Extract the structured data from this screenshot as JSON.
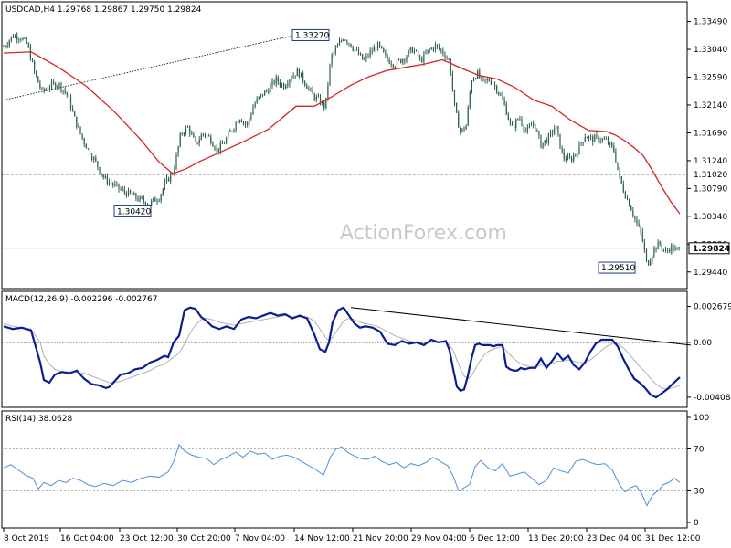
{
  "header": {
    "symbol_tf": "USDCAD,H4",
    "ohlc": "1.29768 1.29867 1.29750 1.29824"
  },
  "watermark": "ActionForex.com",
  "colors": {
    "candle": "#2f5f4f",
    "ma": "#d42424",
    "macd": "#0a1f8f",
    "signal": "#b0b0b0",
    "rsi": "#4a90d9",
    "trendline": "#000000",
    "frame": "#000000",
    "level_line": "#000000",
    "current_price_line": "#9a9a9a"
  },
  "chart_data": [
    {
      "type": "candlestick",
      "panel": "price",
      "y_ticks": [
        "1.33490",
        "1.33040",
        "1.32590",
        "1.32140",
        "1.31690",
        "1.31240",
        "1.30790",
        "1.30340",
        "1.29890",
        "1.29440"
      ],
      "ylim": [
        1.2923,
        1.3372
      ],
      "close_path": {
        "x": [
          0,
          10,
          18,
          26,
          34,
          42,
          50,
          60,
          70,
          78,
          86,
          94,
          102,
          110,
          120,
          130,
          140,
          150,
          160,
          170,
          178,
          186,
          194,
          202,
          210,
          218,
          226,
          234,
          242,
          250,
          258,
          266,
          274,
          282,
          290,
          298,
          306,
          314,
          322,
          330,
          338,
          346,
          352,
          358,
          366,
          372,
          378,
          386,
          394,
          402,
          410,
          418,
          428,
          438,
          448,
          456,
          464,
          472,
          480,
          488,
          494,
          500,
          506,
          512,
          518,
          524,
          532,
          540,
          548,
          556,
          564,
          572,
          580,
          588,
          596,
          604,
          612,
          620,
          628,
          636,
          644,
          652,
          660,
          668,
          674,
          680,
          686,
          692,
          698,
          704,
          708,
          712,
          718,
          724,
          730,
          736,
          740
        ],
        "close": [
          1.3308,
          1.3326,
          1.3324,
          1.3312,
          1.3265,
          1.3235,
          1.3245,
          1.3248,
          1.323,
          1.319,
          1.316,
          1.3138,
          1.3118,
          1.3095,
          1.3085,
          1.3075,
          1.3068,
          1.306,
          1.3055,
          1.3065,
          1.309,
          1.3108,
          1.3168,
          1.3178,
          1.315,
          1.3168,
          1.316,
          1.314,
          1.3155,
          1.3175,
          1.3195,
          1.318,
          1.3215,
          1.323,
          1.324,
          1.3255,
          1.3245,
          1.326,
          1.3268,
          1.325,
          1.323,
          1.322,
          1.321,
          1.329,
          1.331,
          1.3324,
          1.3315,
          1.33,
          1.3285,
          1.33,
          1.331,
          1.329,
          1.328,
          1.329,
          1.3305,
          1.3285,
          1.33,
          1.331,
          1.33,
          1.3285,
          1.3205,
          1.317,
          1.318,
          1.3255,
          1.3265,
          1.325,
          1.3255,
          1.324,
          1.3215,
          1.3175,
          1.3195,
          1.317,
          1.3185,
          1.315,
          1.316,
          1.318,
          1.313,
          1.3125,
          1.314,
          1.3165,
          1.3158,
          1.316,
          1.3155,
          1.314,
          1.3095,
          1.307,
          1.305,
          1.3025,
          1.3005,
          1.2955,
          1.2968,
          1.2982,
          1.299,
          1.2975,
          1.2985,
          1.2978,
          1.2982
        ]
      },
      "moving_average": {
        "x": [
          0,
          30,
          60,
          90,
          120,
          150,
          170,
          185,
          200,
          215,
          230,
          260,
          290,
          320,
          340,
          360,
          380,
          400,
          420,
          440,
          460,
          480,
          490,
          500,
          520,
          540,
          560,
          580,
          600,
          620,
          640,
          660,
          670,
          680,
          690,
          700,
          710,
          720,
          730,
          740
        ],
        "value": [
          1.3298,
          1.33,
          1.3275,
          1.3245,
          1.3205,
          1.3158,
          1.3122,
          1.3103,
          1.3111,
          1.3123,
          1.3133,
          1.3153,
          1.3175,
          1.3212,
          1.3212,
          1.3228,
          1.3246,
          1.326,
          1.327,
          1.3275,
          1.328,
          1.3287,
          1.3281,
          1.3274,
          1.3262,
          1.3256,
          1.3242,
          1.3222,
          1.3212,
          1.319,
          1.3173,
          1.3171,
          1.3165,
          1.3156,
          1.3145,
          1.3132,
          1.3108,
          1.3082,
          1.3058,
          1.3038
        ]
      },
      "annotations": [
        {
          "label": "1.33270",
          "value": 1.3327
        },
        {
          "label": "1.30420",
          "value": 1.3042
        },
        {
          "label": "1.29510",
          "value": 1.2951
        },
        {
          "label": "1.31020",
          "value": 1.3102
        },
        {
          "label": "1.29824",
          "value": 1.29824
        }
      ]
    },
    {
      "type": "line",
      "panel": "macd",
      "title": "MACD(12,26,9) -0.002296 -0.002767",
      "y_ticks": [
        "0.002679",
        "0.00",
        "-0.004086"
      ],
      "ylim": [
        -0.0045,
        0.0034
      ],
      "x": [
        0,
        10,
        20,
        30,
        40,
        44,
        50,
        56,
        64,
        72,
        80,
        88,
        96,
        104,
        112,
        116,
        120,
        128,
        136,
        144,
        152,
        160,
        168,
        176,
        180,
        186,
        192,
        198,
        204,
        210,
        216,
        222,
        228,
        236,
        244,
        252,
        260,
        268,
        276,
        284,
        292,
        300,
        308,
        316,
        324,
        332,
        340,
        346,
        352,
        356,
        360,
        366,
        372,
        378,
        384,
        390,
        396,
        404,
        412,
        420,
        428,
        436,
        444,
        452,
        460,
        468,
        476,
        484,
        488,
        492,
        496,
        500,
        504,
        508,
        512,
        516,
        520,
        524,
        528,
        532,
        536,
        540,
        546,
        550,
        554,
        558,
        562,
        566,
        570,
        576,
        582,
        588,
        594,
        600,
        606,
        612,
        618,
        624,
        630,
        636,
        642,
        648,
        654,
        660,
        666,
        672,
        678,
        684,
        690,
        696,
        702,
        708,
        714,
        720,
        726,
        732,
        740
      ],
      "macd": [
        0.0012,
        0.001,
        0.0011,
        0.0009,
        -0.0015,
        -0.0028,
        -0.003,
        -0.0024,
        -0.0022,
        -0.0023,
        -0.0021,
        -0.0027,
        -0.0031,
        -0.0032,
        -0.0034,
        -0.0033,
        -0.003,
        -0.0024,
        -0.0023,
        -0.002,
        -0.0019,
        -0.0015,
        -0.0013,
        -0.001,
        -0.0011,
        0.0,
        0.0005,
        0.0024,
        0.0026,
        0.0025,
        0.0019,
        0.0016,
        0.0012,
        0.001,
        0.0012,
        0.001,
        0.0017,
        0.0019,
        0.0018,
        0.002,
        0.0022,
        0.002,
        0.0021,
        0.0018,
        0.002,
        0.0018,
        0.0006,
        -0.0005,
        -0.0007,
        0.0,
        0.0015,
        0.0024,
        0.0026,
        0.002,
        0.0014,
        0.0011,
        0.0012,
        0.0011,
        0.0008,
        -0.0001,
        -0.0002,
        0.0001,
        -0.0001,
        0.0,
        -0.0002,
        0.0002,
        0.0,
        0.0001,
        -0.0006,
        -0.002,
        -0.0033,
        -0.0036,
        -0.0035,
        -0.0025,
        -0.0012,
        -0.0002,
        -0.0001,
        -0.0002,
        -0.0002,
        -0.0002,
        -0.0003,
        -0.0002,
        -0.0002,
        -0.0018,
        -0.002,
        -0.0021,
        -0.0021,
        -0.0019,
        -0.002,
        -0.0019,
        -0.0019,
        -0.0012,
        -0.0019,
        -0.0014,
        -0.0008,
        -0.0013,
        -0.001,
        -0.0017,
        -0.002,
        -0.0015,
        -0.0007,
        -0.0001,
        0.0002,
        0.0002,
        0.0002,
        -0.0003,
        -0.0012,
        -0.002,
        -0.0027,
        -0.003,
        -0.0034,
        -0.0039,
        -0.0041,
        -0.0038,
        -0.0035,
        -0.0031,
        -0.0026
      ],
      "signal": [
        0.0014,
        0.0012,
        0.0011,
        0.001,
        0.0,
        -0.001,
        -0.0016,
        -0.002,
        -0.0022,
        -0.0022,
        -0.0022,
        -0.0023,
        -0.0025,
        -0.0027,
        -0.0029,
        -0.003,
        -0.003,
        -0.0029,
        -0.0027,
        -0.0025,
        -0.0023,
        -0.0021,
        -0.0018,
        -0.0016,
        -0.0014,
        -0.0011,
        -0.0008,
        -0.0001,
        0.0007,
        0.0013,
        0.0017,
        0.0018,
        0.0017,
        0.0015,
        0.0014,
        0.0013,
        0.0014,
        0.0015,
        0.0016,
        0.0017,
        0.0018,
        0.0019,
        0.002,
        0.0019,
        0.0019,
        0.0019,
        0.0016,
        0.001,
        0.0004,
        0.0001,
        0.0004,
        0.001,
        0.0016,
        0.0018,
        0.0017,
        0.0015,
        0.0014,
        0.0013,
        0.0011,
        0.0008,
        0.0005,
        0.0003,
        0.0001,
        0.0,
        -0.0001,
        0.0,
        0.0,
        0.0,
        -0.0002,
        -0.0006,
        -0.0013,
        -0.002,
        -0.0025,
        -0.0027,
        -0.0025,
        -0.002,
        -0.0015,
        -0.0011,
        -0.0008,
        -0.0006,
        -0.0005,
        -0.0004,
        -0.0003,
        -0.0006,
        -0.0009,
        -0.0012,
        -0.0014,
        -0.0016,
        -0.0017,
        -0.0018,
        -0.0018,
        -0.0017,
        -0.0017,
        -0.0016,
        -0.0014,
        -0.0014,
        -0.0013,
        -0.0014,
        -0.0015,
        -0.0015,
        -0.0013,
        -0.001,
        -0.0006,
        -0.0003,
        -0.0001,
        -0.0001,
        -0.0004,
        -0.0008,
        -0.0013,
        -0.0018,
        -0.0022,
        -0.0027,
        -0.0031,
        -0.0034,
        -0.0035,
        -0.0034,
        -0.0032
      ],
      "trendline": {
        "x": [
          380,
          752
        ],
        "y": [
          0.0026,
          -0.0002
        ]
      }
    },
    {
      "type": "line",
      "panel": "rsi",
      "title": "RSI(14) 38.0628",
      "y_ticks": [
        "100",
        "70",
        "30",
        "0"
      ],
      "levels": [
        70,
        30
      ],
      "ylim": [
        0,
        100
      ],
      "x": [
        0,
        8,
        16,
        24,
        32,
        38,
        44,
        52,
        60,
        68,
        76,
        84,
        92,
        100,
        110,
        120,
        130,
        140,
        150,
        160,
        170,
        180,
        186,
        192,
        198,
        206,
        214,
        222,
        230,
        238,
        246,
        254,
        262,
        270,
        278,
        286,
        294,
        302,
        310,
        318,
        326,
        334,
        342,
        350,
        358,
        364,
        370,
        376,
        382,
        390,
        398,
        406,
        414,
        422,
        430,
        438,
        446,
        454,
        462,
        470,
        478,
        486,
        492,
        498,
        504,
        510,
        516,
        522,
        530,
        538,
        546,
        554,
        562,
        570,
        578,
        586,
        594,
        602,
        610,
        618,
        626,
        634,
        642,
        650,
        658,
        666,
        674,
        680,
        686,
        692,
        698,
        704,
        710,
        716,
        722,
        728,
        734,
        740
      ],
      "rsi": [
        52,
        55,
        50,
        45,
        42,
        32,
        38,
        35,
        40,
        38,
        42,
        40,
        36,
        34,
        37,
        35,
        40,
        38,
        42,
        44,
        43,
        48,
        58,
        74,
        68,
        64,
        62,
        61,
        55,
        60,
        63,
        67,
        62,
        68,
        65,
        66,
        60,
        63,
        64,
        62,
        58,
        54,
        50,
        45,
        63,
        70,
        72,
        67,
        64,
        61,
        60,
        63,
        58,
        55,
        57,
        52,
        56,
        54,
        57,
        62,
        58,
        54,
        44,
        30,
        33,
        36,
        53,
        59,
        52,
        49,
        56,
        44,
        46,
        48,
        42,
        36,
        40,
        52,
        49,
        47,
        58,
        60,
        57,
        55,
        56,
        50,
        36,
        29,
        33,
        35,
        28,
        16,
        26,
        30,
        36,
        38,
        42,
        38
      ]
    }
  ],
  "x_axis_labels": [
    "8 Oct 2019",
    "16 Oct 04:00",
    "23 Oct 12:00",
    "30 Oct 20:00",
    "7 Nov 04:00",
    "14 Nov 12:00",
    "21 Nov 20:00",
    "29 Nov 04:00",
    "6 Dec 12:00",
    "13 Dec 20:00",
    "23 Dec 04:00",
    "31 Dec 12:00"
  ]
}
